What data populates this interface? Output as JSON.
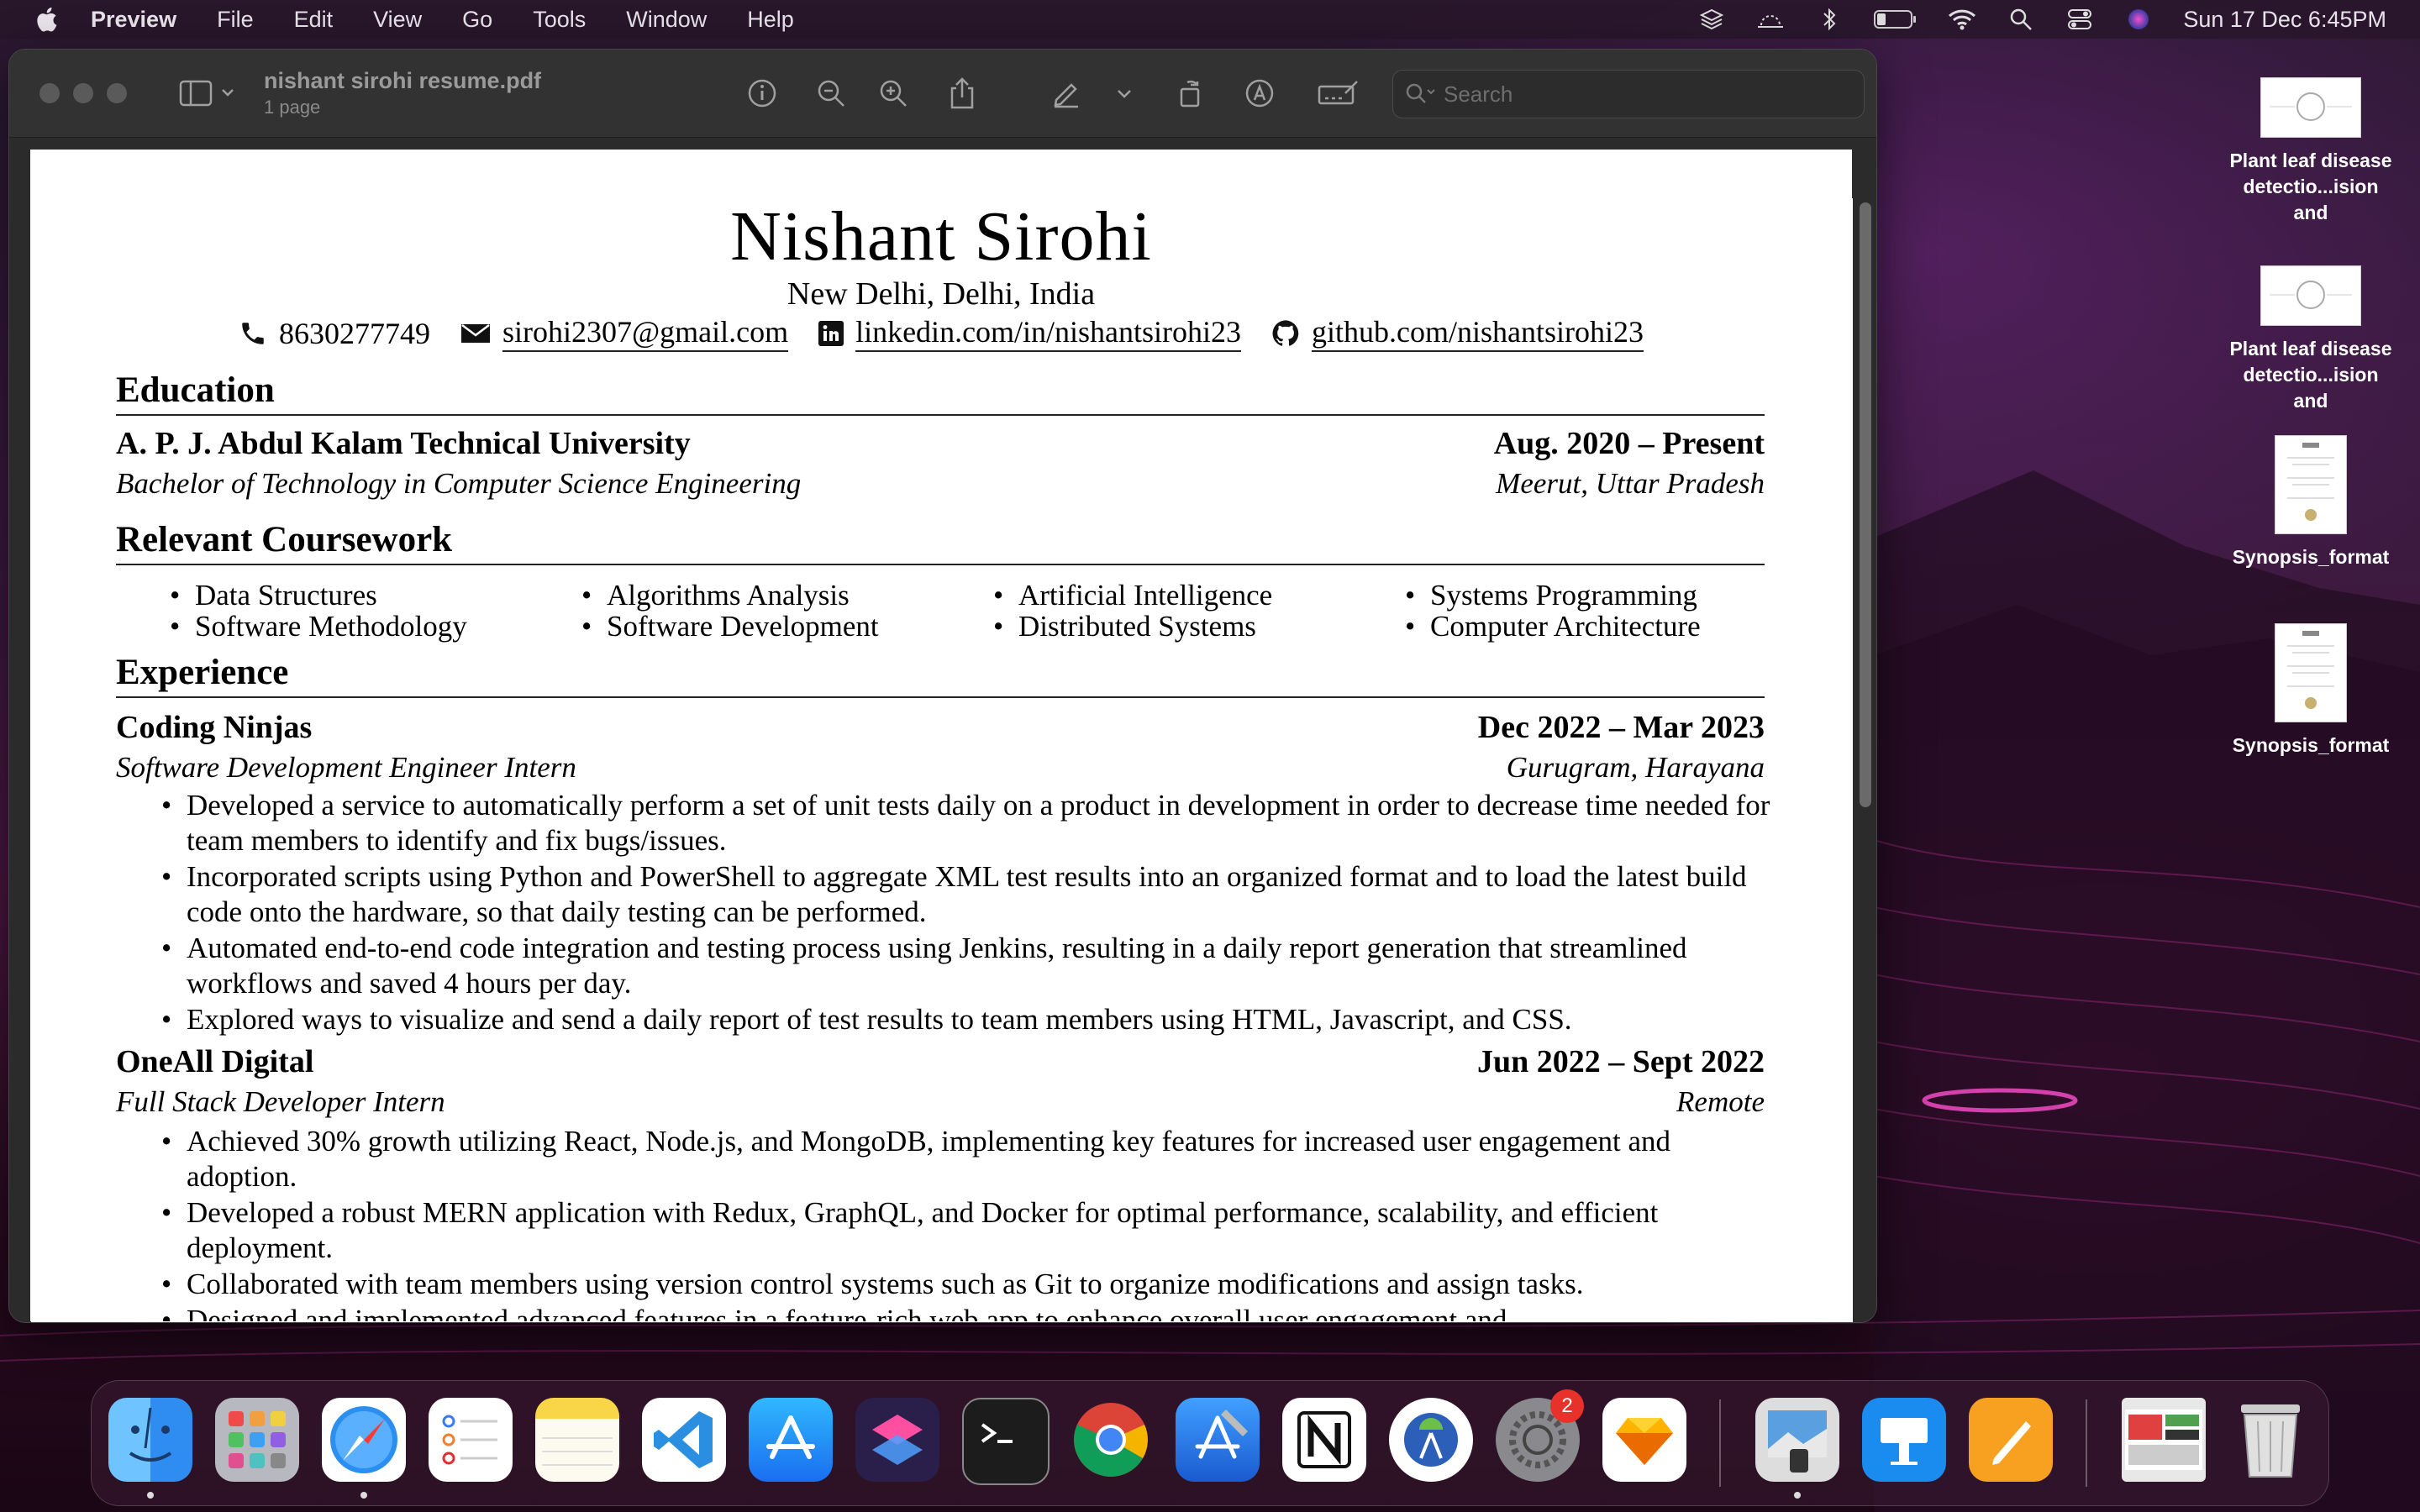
{
  "menubar": {
    "app_name": "Preview",
    "menus": [
      "File",
      "Edit",
      "View",
      "Go",
      "Tools",
      "Window",
      "Help"
    ],
    "clock": "Sun 17 Dec  6:45PM"
  },
  "window": {
    "doc_title": "nishant sirohi resume.pdf",
    "doc_subtitle": "1 page",
    "search_placeholder": "Search"
  },
  "resume": {
    "name": "Nishant Sirohi",
    "location": "New Delhi, Delhi, India",
    "phone": "8630277749",
    "email": "sirohi2307@gmail.com",
    "linkedin": "linkedin.com/in/nishantsirohi23",
    "github": "github.com/nishantsirohi23",
    "education_title": "Education",
    "university": "A. P. J. Abdul Kalam Technical University",
    "edu_dates": "Aug. 2020 – Present",
    "degree": "Bachelor of Technology in Computer Science Engineering",
    "edu_location": "Meerut, Uttar Pradesh",
    "coursework_title": "Relevant Coursework",
    "coursework": [
      [
        "Data Structures",
        "Software Methodology"
      ],
      [
        "Algorithms Analysis",
        "Software Development"
      ],
      [
        "Artificial Intelligence",
        "Distributed Systems"
      ],
      [
        "Systems Programming",
        "Computer Architecture"
      ]
    ],
    "experience_title": "Experience",
    "jobs": [
      {
        "company": "Coding Ninjas",
        "dates": "Dec 2022 – Mar 2023",
        "role": "Software Development Engineer Intern",
        "location": "Gurugram, Harayana",
        "bullets": [
          "Developed a service to automatically perform a set of unit tests daily on a product in development in order to decrease time needed for team members to identify and fix bugs/issues.",
          "Incorporated scripts using Python and PowerShell to aggregate XML test results into an organized format and to load the latest build code onto the hardware, so that daily testing can be performed.",
          "Automated end-to-end code integration and testing process using Jenkins, resulting in a daily report generation that streamlined workflows and saved 4 hours per day.",
          "Explored ways to visualize and send a daily report of test results to team members using HTML, Javascript, and CSS."
        ]
      },
      {
        "company": "OneAll Digital",
        "dates": "Jun 2022 – Sept 2022",
        "role": "Full Stack Developer Intern",
        "location": "Remote",
        "bullets": [
          "Achieved 30% growth utilizing React, Node.js, and MongoDB, implementing key features for increased user engagement and adoption.",
          "Developed a robust MERN application with Redux, GraphQL, and Docker for optimal performance, scalability, and efficient deployment.",
          "Collaborated with team members using version control systems such as Git to organize modifications and assign tasks.",
          "Designed and implemented advanced features in a feature-rich web app to enhance overall user engagement and"
        ]
      }
    ]
  },
  "desktop": [
    {
      "label1": "Plant leaf disease",
      "label2": "detectio...ision and"
    },
    {
      "label1": "Plant leaf disease",
      "label2": "detectio...ision and"
    },
    {
      "label1": "Synopsis_format",
      "label2": ""
    },
    {
      "label1": "Synopsis_format",
      "label2": ""
    }
  ],
  "dock": {
    "settings_badge": "2",
    "apps": [
      "Finder",
      "Launchpad",
      "Safari",
      "Reminders",
      "Notes",
      "Visual Studio Code",
      "App Store",
      "Shortcuts",
      "Terminal",
      "Google Chrome",
      "Xcode",
      "Notion",
      "Android Studio",
      "System Settings",
      "Sketch",
      "Preview",
      "Keynote",
      "Pages",
      "Downloads",
      "Trash"
    ]
  }
}
